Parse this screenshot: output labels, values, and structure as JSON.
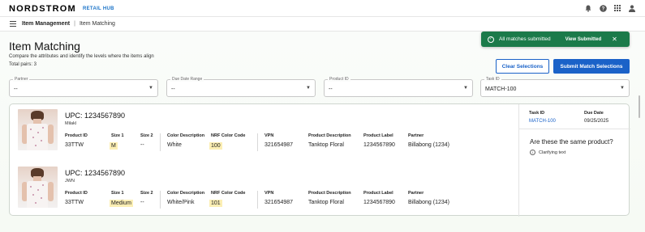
{
  "app": {
    "logo": "NORDSTROM",
    "logo_sub": "RETAIL HUB"
  },
  "top_icons": [
    "bell-icon",
    "help-icon",
    "apps-grid-icon",
    "user-icon"
  ],
  "breadcrumb": {
    "section": "Item Management",
    "separator": "|",
    "page": "Item Matching"
  },
  "page": {
    "title": "Item Matching",
    "subtitle": "Compare the attributes and identify the levels where the items align",
    "total": "Total pairs: 3"
  },
  "toast": {
    "message": "All matches submitted",
    "action": "View Submitted",
    "close": "✕"
  },
  "buttons": {
    "clear": "Clear Selections",
    "submit": "Submit Match Selections"
  },
  "filters": [
    {
      "label": "Partner",
      "value": "--"
    },
    {
      "label": "Due Date Range",
      "value": "--"
    },
    {
      "label": "Product ID",
      "value": "--"
    },
    {
      "label": "Task ID",
      "value": "MATCH-100"
    }
  ],
  "headers": {
    "product_id": "Product ID",
    "size1": "Size 1",
    "size2": "Size 2",
    "color_desc": "Color Description",
    "nrf": "NRF Color Code",
    "vpn": "VPN",
    "prod_desc": "Product Description",
    "prod_label": "Product Label",
    "partner": "Partner"
  },
  "items": [
    {
      "upc": "UPC: 1234567890",
      "brand": "Milakl",
      "product_id": "33TTW",
      "size1": "M",
      "size2": "--",
      "color_desc": "White",
      "nrf": "100",
      "vpn": "321654987",
      "prod_desc": "Tanktop Floral",
      "prod_label": "1234567890",
      "partner": "Billabong (1234)"
    },
    {
      "upc": "UPC: 1234567890",
      "brand": "JWN",
      "product_id": "33TTW",
      "size1": "Medium",
      "size2": "--",
      "color_desc": "White/Pink",
      "nrf": "101",
      "vpn": "321654987",
      "prod_desc": "Tanktop Floral",
      "prod_label": "1234567890",
      "partner": "Billabong (1234)"
    }
  ],
  "side": {
    "task_label": "Task ID",
    "task_value": "MATCH-100",
    "due_label": "Due Date",
    "due_value": "09/25/2025",
    "question": "Are these the same product?",
    "hint": "Clarifying text"
  },
  "colors": {
    "primary": "#1a62c8",
    "toast": "#1b7a4a",
    "highlight": "#fcefb4"
  }
}
